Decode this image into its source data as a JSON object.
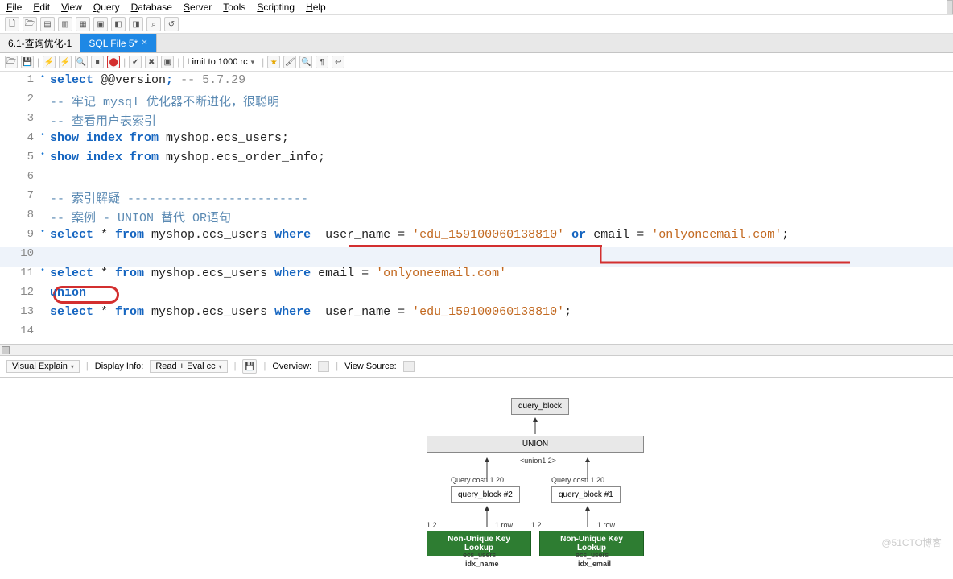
{
  "menu": {
    "items": [
      "File",
      "Edit",
      "View",
      "Query",
      "Database",
      "Server",
      "Tools",
      "Scripting",
      "Help"
    ]
  },
  "tabs": [
    {
      "label": "6.1-查询优化-1",
      "active": false
    },
    {
      "label": "SQL File 5*",
      "active": true
    }
  ],
  "limit_label": "Limit to 1000 rc",
  "editor": {
    "lines": [
      {
        "n": 1,
        "dot": true,
        "tokens": [
          [
            "kw",
            "select"
          ],
          [
            "ident",
            " @@version"
          ],
          [
            "kw",
            ";"
          ],
          [
            "ident",
            " "
          ],
          [
            "com",
            "-- 5.7.29"
          ]
        ]
      },
      {
        "n": 2,
        "dot": false,
        "tokens": [
          [
            "comCN",
            "-- 牢记 mysql 优化器不断进化，很聪明"
          ]
        ]
      },
      {
        "n": 3,
        "dot": false,
        "tokens": [
          [
            "comCN",
            "-- 查看用户表索引"
          ]
        ]
      },
      {
        "n": 4,
        "dot": true,
        "tokens": [
          [
            "kw",
            "show index from"
          ],
          [
            "ident",
            " myshop.ecs_users;"
          ]
        ]
      },
      {
        "n": 5,
        "dot": true,
        "tokens": [
          [
            "kw",
            "show index from"
          ],
          [
            "ident",
            " myshop.ecs_order_info;"
          ]
        ]
      },
      {
        "n": 6,
        "dot": false,
        "tokens": [
          [
            "ident",
            ""
          ]
        ]
      },
      {
        "n": 7,
        "dot": false,
        "tokens": [
          [
            "comCN",
            "-- 索引解疑 -------------------------"
          ]
        ]
      },
      {
        "n": 8,
        "dot": false,
        "tokens": [
          [
            "comCN",
            "-- 案例 - UNION 替代 OR语句"
          ]
        ]
      },
      {
        "n": 9,
        "dot": true,
        "tokens": [
          [
            "kw",
            "select"
          ],
          [
            "ident",
            " * "
          ],
          [
            "kw",
            "from"
          ],
          [
            "ident",
            " myshop.ecs_users "
          ],
          [
            "kw",
            "where"
          ],
          [
            "ident",
            "  user_name = "
          ],
          [
            "str",
            "'edu_159100060138810'"
          ],
          [
            "ident",
            " "
          ],
          [
            "kw",
            "or"
          ],
          [
            "ident",
            " email = "
          ],
          [
            "str",
            "'onlyoneemail.com'"
          ],
          [
            "ident",
            ";"
          ]
        ]
      },
      {
        "n": 10,
        "dot": false,
        "hl": true,
        "tokens": [
          [
            "ident",
            ""
          ]
        ]
      },
      {
        "n": 11,
        "dot": true,
        "tokens": [
          [
            "kw",
            "select"
          ],
          [
            "ident",
            " * "
          ],
          [
            "kw",
            "from"
          ],
          [
            "ident",
            " myshop.ecs_users "
          ],
          [
            "kw",
            "where"
          ],
          [
            "ident",
            " email = "
          ],
          [
            "str",
            "'onlyoneemail.com'"
          ]
        ]
      },
      {
        "n": 12,
        "dot": false,
        "tokens": [
          [
            "kw",
            "union"
          ]
        ]
      },
      {
        "n": 13,
        "dot": false,
        "tokens": [
          [
            "kw",
            "select"
          ],
          [
            "ident",
            " * "
          ],
          [
            "kw",
            "from"
          ],
          [
            "ident",
            " myshop.ecs_users "
          ],
          [
            "kw",
            "where"
          ],
          [
            "ident",
            "  user_name = "
          ],
          [
            "str",
            "'edu_159100060138810'"
          ],
          [
            "ident",
            ";"
          ]
        ]
      },
      {
        "n": 14,
        "dot": false,
        "tokens": [
          [
            "ident",
            ""
          ]
        ]
      }
    ]
  },
  "bottom": {
    "visual_explain": "Visual Explain",
    "display_info_label": "Display Info:",
    "display_info_value": "Read + Eval cc",
    "overview": "Overview:",
    "view_source": "View Source:"
  },
  "explain": {
    "query_block": "query_block",
    "union": "UNION",
    "union_sub": "<union1,2>",
    "qc_label": "Query cost:",
    "qc_value": "1.20",
    "qb2": "query_block #2",
    "qb1": "query_block #1",
    "left_num": "1.2",
    "rows": "1 row",
    "lookup": "Non-Unique Key Lookup",
    "ecs_users": "ecs_users",
    "idx_name": "idx_name",
    "idx_email": "idx_email"
  },
  "watermark": "@51CTO博客"
}
